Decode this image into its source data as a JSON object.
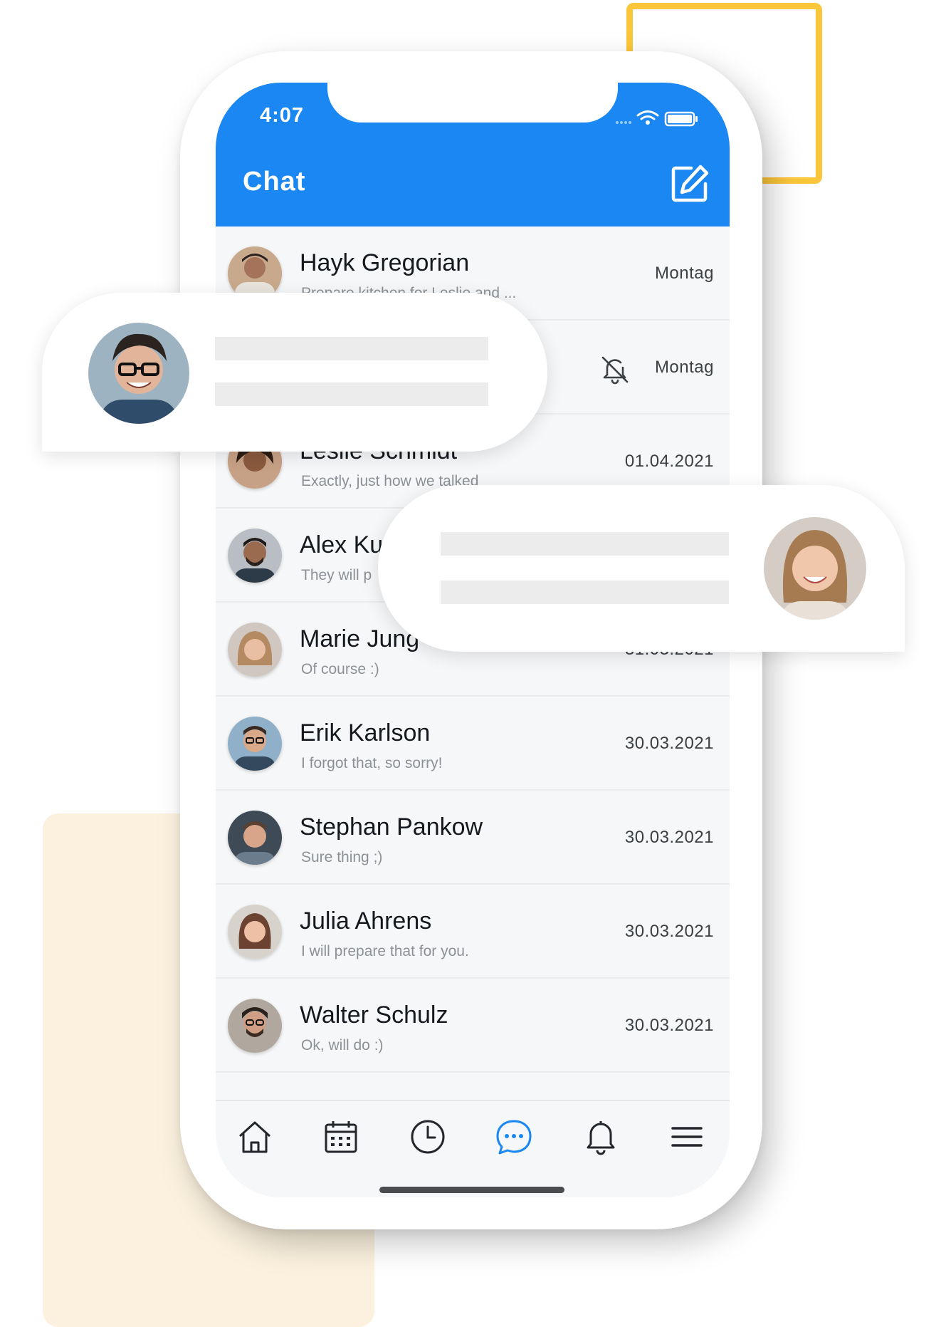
{
  "status_bar": {
    "time": "4:07"
  },
  "header": {
    "title": "Chat",
    "compose_icon": "compose-icon"
  },
  "chats": [
    {
      "name": "Hayk Gregorian",
      "preview": "Prepare kitchen for Leslie and ...",
      "date": "Montag",
      "muted": false
    },
    {
      "name": "",
      "preview": "",
      "date": "Montag",
      "muted": true
    },
    {
      "name": "Leslie Schmidt",
      "preview": "Exactly, just how we talked",
      "date": "01.04.2021",
      "muted": false
    },
    {
      "name": "Alex Ku",
      "preview": "They will p",
      "date": "",
      "muted": false
    },
    {
      "name": "Marie Jung",
      "preview": "Of course :)",
      "date": "31.03.2021",
      "muted": false
    },
    {
      "name": "Erik Karlson",
      "preview": "I forgot that, so sorry!",
      "date": "30.03.2021",
      "muted": false
    },
    {
      "name": "Stephan Pankow",
      "preview": "Sure thing ;)",
      "date": "30.03.2021",
      "muted": false
    },
    {
      "name": "Julia Ahrens",
      "preview": "I will prepare that for you.",
      "date": "30.03.2021",
      "muted": false
    },
    {
      "name": "Walter Schulz",
      "preview": "Ok, will do :)",
      "date": "30.03.2021",
      "muted": false
    }
  ],
  "tabbar": {
    "active": "chat",
    "items": [
      "home-icon",
      "calendar-icon",
      "clock-icon",
      "chat-icon",
      "bell-icon",
      "menu-icon"
    ]
  },
  "colors": {
    "accent": "#1b87f2",
    "yellow": "#fcc63b",
    "cream": "#fbf1de"
  }
}
